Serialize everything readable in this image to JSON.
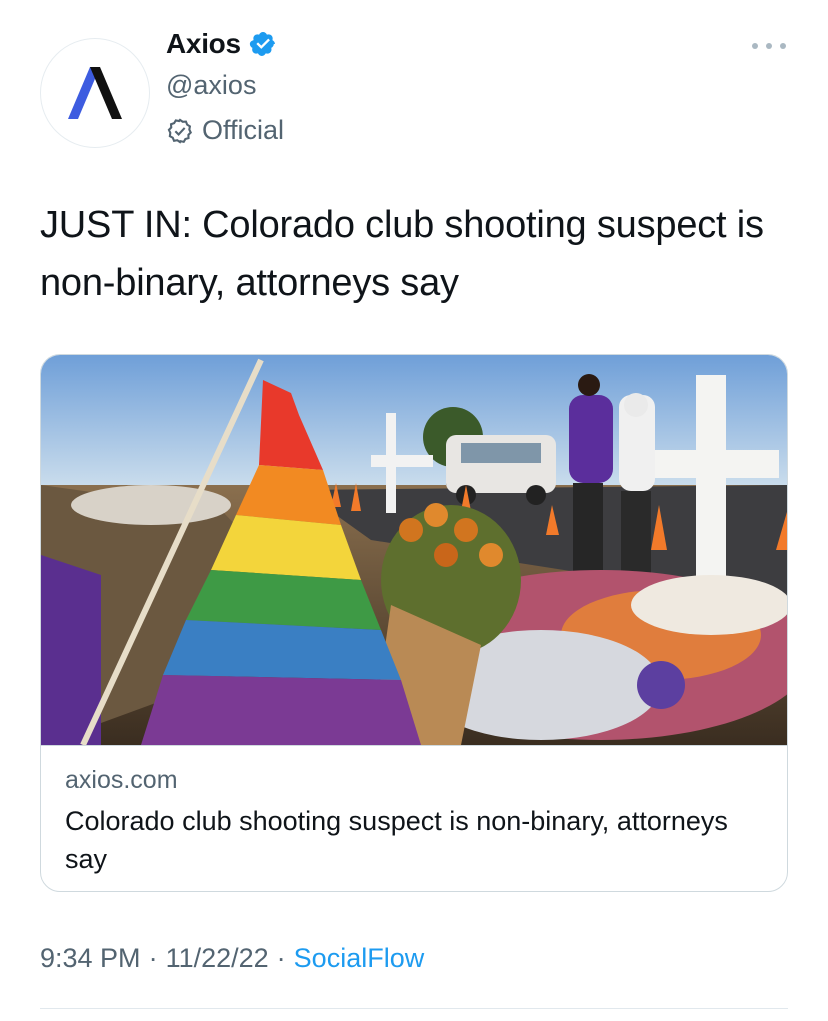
{
  "account": {
    "name": "Axios",
    "handle": "@axios",
    "official_label": "Official",
    "avatar_icon": "axios-logo-icon",
    "verified_icon": "verified-badge-icon",
    "official_icon": "official-check-icon"
  },
  "tweet": {
    "text": "JUST IN: Colorado club shooting suspect is non-binary, attorneys say"
  },
  "card": {
    "domain": "axios.com",
    "title": "Colorado club shooting suspect is non-binary, attorneys say",
    "image_alt": "Memorial with rainbow flag, flowers and white crosses"
  },
  "meta": {
    "time": "9:34 PM",
    "separator": "·",
    "date": "11/22/22",
    "source": "SocialFlow"
  },
  "colors": {
    "accent": "#1d9bf0",
    "text": "#0f1419",
    "secondary": "#536471",
    "border": "#cfd9de"
  }
}
